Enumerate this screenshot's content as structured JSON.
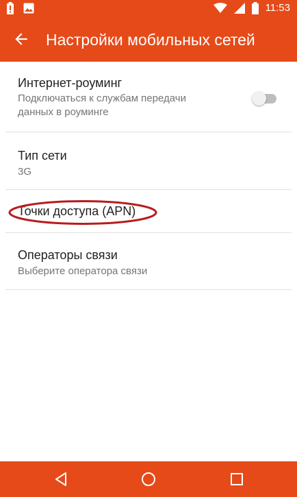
{
  "status_bar": {
    "time": "11:53",
    "icons": [
      "battery-alert-icon",
      "image-icon",
      "wifi-icon",
      "signal-icon",
      "battery-icon"
    ]
  },
  "app_bar": {
    "title": "Настройки мобильных сетей",
    "back_icon": "arrow-back-icon"
  },
  "settings": {
    "roaming": {
      "title": "Интернет-роуминг",
      "summary": "Подключаться к службам передачи данных в роуминге",
      "toggle_on": false
    },
    "network_type": {
      "title": "Тип сети",
      "value": "3G"
    },
    "apn": {
      "title": "Точки доступа (APN)"
    },
    "operators": {
      "title": "Операторы связи",
      "summary": "Выберите оператора связи"
    }
  },
  "nav_bar": {
    "icons": [
      "back-triangle-icon",
      "home-circle-icon",
      "recents-square-icon"
    ]
  },
  "colors": {
    "accent": "#e64a19",
    "highlight": "#b71c1c"
  }
}
